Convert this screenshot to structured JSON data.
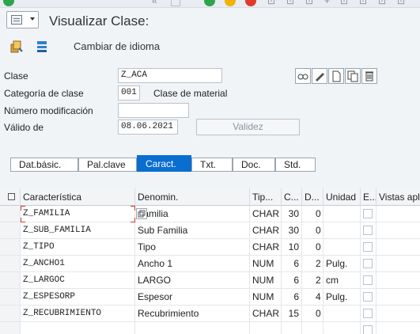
{
  "title_bar": {
    "title": "Visualizar Clase:"
  },
  "app_toolbar": {
    "change_language_label": "Cambiar de idioma"
  },
  "form": {
    "clase": {
      "label": "Clase",
      "value": "Z_ACA"
    },
    "categoria": {
      "label": "Categoría de clase",
      "value": "001",
      "description": "Clase de material"
    },
    "numero_modificacion": {
      "label": "Número modificación",
      "value": ""
    },
    "valido_de": {
      "label": "Válido de",
      "value": "08.06.2021"
    },
    "validez_button": "Validez"
  },
  "tabs": [
    {
      "label": "Dat.básic."
    },
    {
      "label": "Pal.clave"
    },
    {
      "label": "Caract."
    },
    {
      "label": "Txt."
    },
    {
      "label": "Doc."
    },
    {
      "label": "Std."
    }
  ],
  "active_tab": "Caract.",
  "grid": {
    "columns": [
      "Característica",
      "Denomin.",
      "Tip...",
      "C...",
      "D...",
      "Unidad",
      "E...",
      "Vistas aplic..."
    ],
    "rows": [
      {
        "caracteristica": "Z_FAMILIA",
        "denom": "Familia",
        "tipo": "CHAR",
        "c": "30",
        "d": "0",
        "unidad": ""
      },
      {
        "caracteristica": "Z_SUB_FAMILIA",
        "denom": "Sub Familia",
        "tipo": "CHAR",
        "c": "30",
        "d": "0",
        "unidad": ""
      },
      {
        "caracteristica": "Z_TIPO",
        "denom": "Tipo",
        "tipo": "CHAR",
        "c": "10",
        "d": "0",
        "unidad": ""
      },
      {
        "caracteristica": "Z_ANCHO1",
        "denom": "Ancho 1",
        "tipo": "NUM",
        "c": "6",
        "d": "2",
        "unidad": "Pulg."
      },
      {
        "caracteristica": "Z_LARGOC",
        "denom": "LARGO",
        "tipo": "NUM",
        "c": "6",
        "d": "2",
        "unidad": "cm"
      },
      {
        "caracteristica": "Z_ESPESORP",
        "denom": "Espesor",
        "tipo": "NUM",
        "c": "6",
        "d": "4",
        "unidad": "Pulg."
      },
      {
        "caracteristica": "Z_RECUBRIMIENTO",
        "denom": "Recubrimiento",
        "tipo": "CHAR",
        "c": "15",
        "d": "0",
        "unidad": ""
      }
    ]
  },
  "colors": {
    "accent": "#0a6ed1",
    "green": "#2fa44f",
    "yellow": "#f0b400",
    "selection": "#d03a2f"
  }
}
